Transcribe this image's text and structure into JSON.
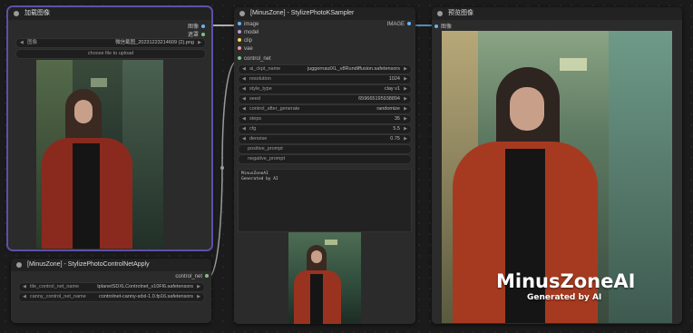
{
  "load_node": {
    "title": "加载图像",
    "outputs": [
      "图像",
      "遮罩"
    ],
    "image_label": "图像",
    "image_value": "微信截图_20231223214609 (2).png",
    "upload_label": "choose file to upload"
  },
  "controlnet_node": {
    "title": "[MinusZone] - StylizePhotoControlNetApply",
    "output": "control_net",
    "widgets": [
      {
        "label": "tile_control_net_name",
        "value": "tplanetSDXLControlnet_v10Fl6.safetensors"
      },
      {
        "label": "canny_control_net_name",
        "value": "controlnet-canny-sdxl-1.0.fp16.safetensors"
      }
    ]
  },
  "sampler_node": {
    "title": "[MinusZone] - StylizePhotoKSampler",
    "inputs": [
      "image",
      "model",
      "clip",
      "vae",
      "control_net"
    ],
    "output": "IMAGE",
    "widgets": [
      {
        "label": "ai_ckpt_name",
        "value": "juggernautXL_v8Rundiffusion.safetensors"
      },
      {
        "label": "resolution",
        "value": "1024"
      },
      {
        "label": "style_type",
        "value": "clay v1"
      },
      {
        "label": "seed",
        "value": "659665195938894"
      },
      {
        "label": "control_after_generate",
        "value": "randomize"
      },
      {
        "label": "steps",
        "value": "35"
      },
      {
        "label": "cfg",
        "value": "5.5"
      },
      {
        "label": "denoise",
        "value": "0.75"
      }
    ],
    "prompt_inputs": [
      "positive_prompt",
      "negative_prompt"
    ],
    "text_lines": [
      "MinusZoneAI",
      "Generated by AI"
    ]
  },
  "preview_node": {
    "title": "预览图像",
    "input": "图像",
    "watermark_title": "MinusZoneAI",
    "watermark_sub": "Generated by AI"
  },
  "colors": {
    "accent": "#5a52a8",
    "link_image": "#64b5f6",
    "link_control": "#a0a0a0"
  }
}
